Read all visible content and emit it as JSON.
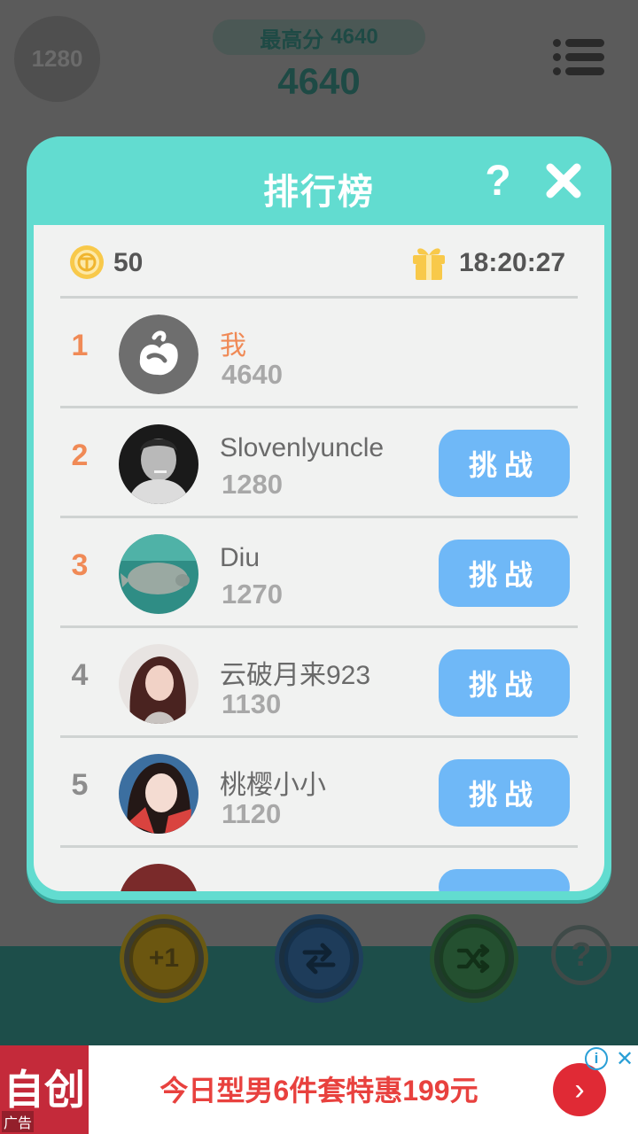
{
  "header": {
    "player_score_badge": "1280",
    "best_label": "最高分",
    "best_value": "4640",
    "current_score": "4640",
    "menu_icon": "hamburger-menu-icon"
  },
  "leaderboard": {
    "title": "排行榜",
    "help_label": "?",
    "close_icon": "close-icon",
    "coins": "50",
    "coin_icon": "coin-icon",
    "gift_icon": "gift-icon",
    "timer": "18:20:27",
    "challenge_label": "挑战",
    "players": [
      {
        "rank": "1",
        "name": "我",
        "score": "4640",
        "is_me": true
      },
      {
        "rank": "2",
        "name": "Slovenlyuncle",
        "score": "1280"
      },
      {
        "rank": "3",
        "name": "Diu",
        "score": "1270"
      },
      {
        "rank": "4",
        "name": "云破月来923",
        "score": "1130"
      },
      {
        "rank": "5",
        "name": "桃樱小小",
        "score": "1120"
      }
    ]
  },
  "game_controls": {
    "plus_one_label": "+1",
    "swap_icon": "swap-arrows-icon",
    "shuffle_icon": "shuffle-icon",
    "help_label": "?"
  },
  "ad": {
    "logo_text": "自创",
    "ad_label": "广告",
    "text": "今日型男6件套特惠199元",
    "arrow": "›",
    "info_icon": "info-icon",
    "close_icon": "close-icon"
  },
  "colors": {
    "modal_teal": "#62dcd0",
    "rank_highlight": "#f08a56",
    "challenge_blue": "#6fb8f7",
    "ad_red": "#e8413e"
  }
}
